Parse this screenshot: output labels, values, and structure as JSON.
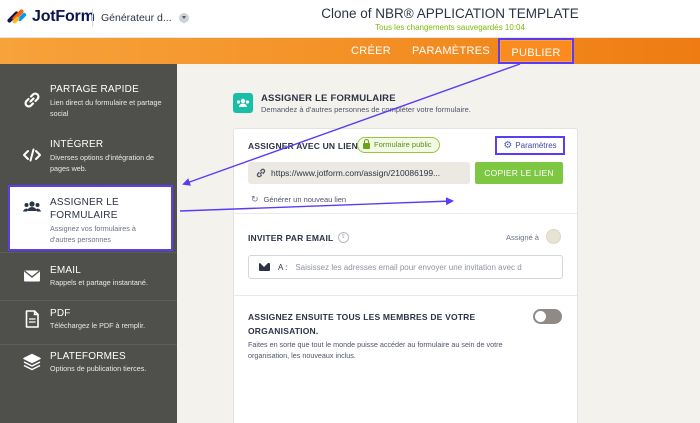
{
  "header": {
    "logo_text": "JotForm",
    "builder_select": "Générateur d...",
    "form_title": "Clone of NBR® APPLICATION TEMPLATE",
    "saved_status": "Tous les changements sauvegardés 10:04"
  },
  "nav": {
    "tabs": [
      {
        "label": "CRÉER"
      },
      {
        "label": "PARAMÈTRES"
      },
      {
        "label": "PUBLIER",
        "active": true
      }
    ]
  },
  "sidebar": {
    "items": [
      {
        "title": "PARTAGE RAPIDE",
        "desc": "Lien direct du formulaire et partage social",
        "icon": "link-icon"
      },
      {
        "title": "INTÉGRER",
        "desc": "Diverses options d'intégration de pages web.",
        "icon": "code-icon"
      },
      {
        "title": "ASSIGNER LE FORMULAIRE",
        "desc": "Assignez vos formulaires à d'autres personnes",
        "icon": "users-icon",
        "active": true
      },
      {
        "title": "EMAIL",
        "desc": "Rappels et partage instantané.",
        "icon": "envelope-icon"
      },
      {
        "title": "PDF",
        "desc": "Téléchargez le PDF à remplir.",
        "icon": "pdf-icon"
      },
      {
        "title": "PLATEFORMES",
        "desc": "Options de publication tierces.",
        "icon": "layers-icon"
      }
    ]
  },
  "main": {
    "section_title": "ASSIGNER LE FORMULAIRE",
    "section_subtitle": "Demandez à d'autres personnes de compléter votre formulaire.",
    "assign_link": {
      "label": "ASSIGNER AVEC UN LIEN",
      "badge": "Formulaire public",
      "settings_button": "Paramètres",
      "url": "https://www.jotform.com/assign/210086199...",
      "copy_button": "COPIER LE LIEN",
      "generate_link": "Générer un nouveau lien"
    },
    "invite": {
      "label": "INVITER PAR EMAIL",
      "assigned_label": "Assigné à",
      "email_prefix": "A :",
      "email_placeholder": "Saisissez les adresses email pour envoyer une invitation avec d"
    },
    "organization": {
      "title": "ASSIGNEZ ENSUITE TOUS LES MEMBRES DE VOTRE ORGANISATION.",
      "description": "Faites en sorte que tout le monde puisse accéder au formulaire au sein de votre organisation, les nouveaux inclus.",
      "toggle_on": false
    }
  },
  "colors": {
    "accent_orange": "#f49328",
    "annotation_purple": "#5b3cf5",
    "sidebar_bg": "#4f4f4b",
    "success_green": "#7dc742",
    "teal_icon": "#18bfa6"
  }
}
